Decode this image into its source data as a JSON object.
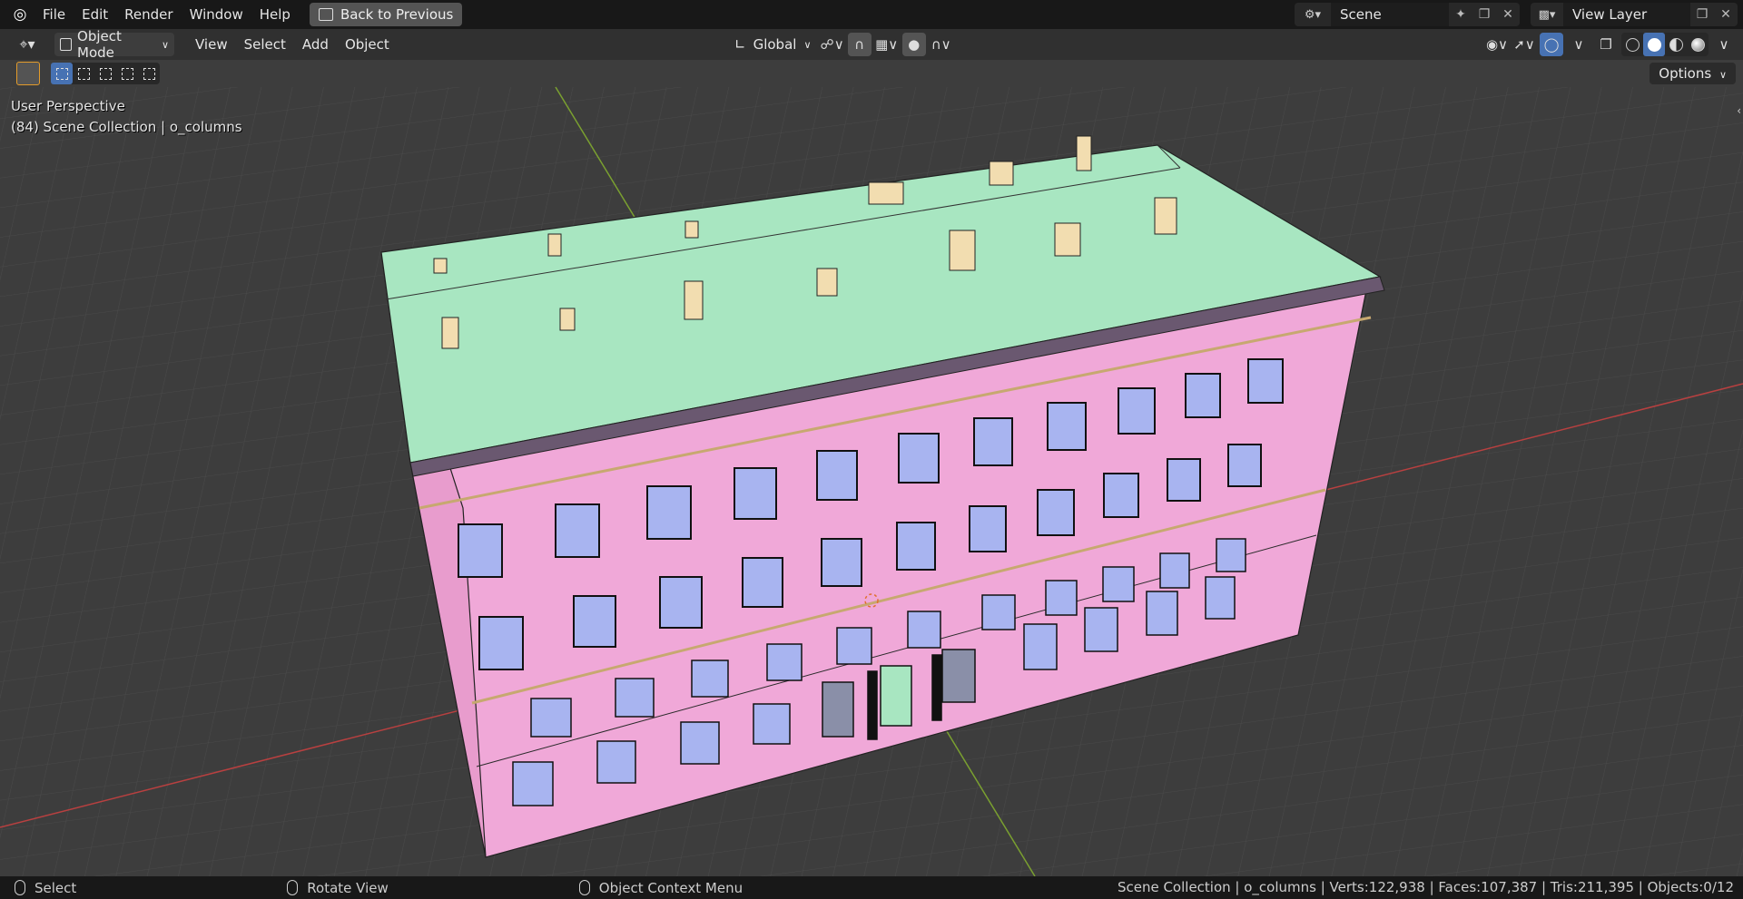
{
  "topbar": {
    "menu": [
      "File",
      "Edit",
      "Render",
      "Window",
      "Help"
    ],
    "back_label": "Back to Previous",
    "scene_name": "Scene",
    "view_layer_name": "View Layer"
  },
  "viewport_header": {
    "mode": "Object Mode",
    "menu": [
      "View",
      "Select",
      "Add",
      "Object"
    ],
    "orientation": "Global"
  },
  "tool_settings": {
    "options_label": "Options"
  },
  "viewport": {
    "perspective_label": "User Perspective",
    "collection_label": "(84) Scene Collection | o_columns"
  },
  "statusbar": {
    "select": "Select",
    "rotate": "Rotate View",
    "context": "Object Context Menu",
    "stats": "Scene Collection | o_columns | Verts:122,938 | Faces:107,387 | Tris:211,395 | Objects:0/12"
  },
  "colors": {
    "roof": "#a8e6c1",
    "wall": "#f0a8d8",
    "window": "#a8b4f0",
    "chimney": "#f2ddb0",
    "x_axis": "#b84040",
    "y_axis": "#7aa030"
  }
}
